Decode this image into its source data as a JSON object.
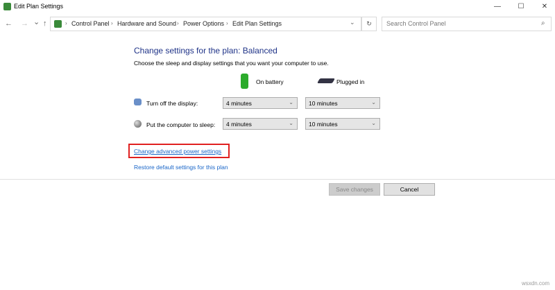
{
  "window": {
    "title": "Edit Plan Settings",
    "min": "—",
    "max": "☐",
    "close": "✕"
  },
  "nav": {
    "back": "←",
    "forward": "→",
    "recent": "⌄",
    "up": "↑",
    "refresh": "↻"
  },
  "breadcrumb": [
    "Control Panel",
    "Hardware and Sound",
    "Power Options",
    "Edit Plan Settings"
  ],
  "breadcrumb_sep": "›",
  "address_dropdown": "⌄",
  "search": {
    "placeholder": "Search Control Panel",
    "icon": "⌕"
  },
  "main": {
    "heading": "Change settings for the plan: Balanced",
    "subtitle": "Choose the sleep and display settings that you want your computer to use.",
    "columns": {
      "battery": "On battery",
      "plugged": "Plugged in"
    },
    "rows": [
      {
        "label": "Turn off the display:",
        "battery": "4 minutes",
        "plugged": "10 minutes"
      },
      {
        "label": "Put the computer to sleep:",
        "battery": "4 minutes",
        "plugged": "10 minutes"
      }
    ],
    "chevron": "⌄",
    "link_advanced": "Change advanced power settings",
    "link_restore": "Restore default settings for this plan",
    "save": "Save changes",
    "cancel": "Cancel"
  },
  "watermark": "wsxdn.com"
}
